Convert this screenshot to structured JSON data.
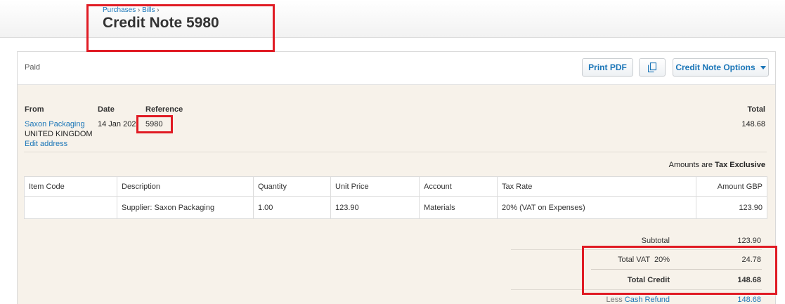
{
  "header": {
    "breadcrumb": [
      "Purchases",
      "Bills"
    ],
    "title": "Credit Note 5980"
  },
  "toolbar": {
    "status": "Paid",
    "print_pdf": "Print PDF",
    "copy_icon": "copy-icon",
    "options": "Credit Note Options"
  },
  "info": {
    "from_label": "From",
    "from_name": "Saxon Packaging",
    "from_country": "UNITED KINGDOM",
    "edit_address": "Edit address",
    "date_label": "Date",
    "date_value": "14 Jan 202",
    "reference_label": "Reference",
    "reference_value": "5980",
    "total_label": "Total",
    "total_value": "148.68"
  },
  "amounts_note": {
    "prefix": "Amounts are",
    "value": "Tax Exclusive"
  },
  "table": {
    "headers": [
      "Item Code",
      "Description",
      "Quantity",
      "Unit Price",
      "Account",
      "Tax Rate",
      "Amount GBP"
    ],
    "rows": [
      [
        "",
        "Supplier: Saxon Packaging",
        "1.00",
        "123.90",
        "Materials",
        "20% (VAT on Expenses)",
        "123.90"
      ]
    ]
  },
  "totals": {
    "subtotal_label": "Subtotal",
    "subtotal_value": "123.90",
    "vat_label": "Total VAT  20%",
    "vat_value": "24.78",
    "total_credit_label": "Total Credit",
    "total_credit_value": "148.68",
    "less_label": "Less",
    "cash_refund_label": "Cash Refund",
    "cash_refund_value": "148.68"
  },
  "colors": {
    "link": "#1b76b8",
    "highlight": "#e01b24",
    "panel": "#f7f2ea"
  }
}
